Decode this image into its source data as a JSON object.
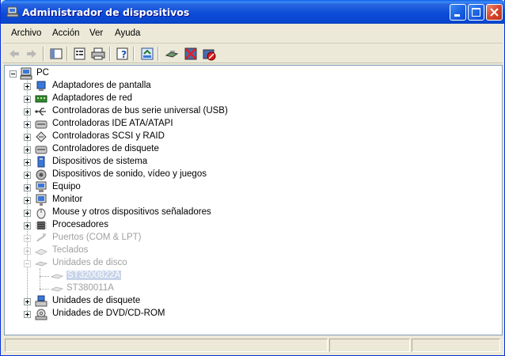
{
  "window": {
    "title": "Administrador de dispositivos",
    "title_bar_color": "#0a4ad8"
  },
  "menu": {
    "items": [
      "Archivo",
      "Acción",
      "Ver",
      "Ayuda"
    ]
  },
  "toolbar": {
    "buttons": [
      "back-arrow-icon",
      "forward-arrow-icon",
      "show-hide-tree-icon",
      "properties-icon",
      "print-icon",
      "help-icon",
      "update-driver-icon",
      "scan-hardware-icon",
      "uninstall-icon",
      "disable-icon"
    ]
  },
  "tree": {
    "root": "PC",
    "items": [
      {
        "label": "Adaptadores de pantalla",
        "icon": "display-adapter-icon",
        "faded": false
      },
      {
        "label": "Adaptadores de red",
        "icon": "network-adapter-icon",
        "faded": false
      },
      {
        "label": "Controladoras de bus serie universal (USB)",
        "icon": "usb-icon",
        "faded": false
      },
      {
        "label": "Controladoras IDE ATA/ATAPI",
        "icon": "ide-controller-icon",
        "faded": false
      },
      {
        "label": "Controladoras SCSI y RAID",
        "icon": "scsi-icon",
        "faded": false
      },
      {
        "label": "Controladores de disquete",
        "icon": "floppy-controller-icon",
        "faded": false
      },
      {
        "label": "Dispositivos de sistema",
        "icon": "system-device-icon",
        "faded": false
      },
      {
        "label": "Dispositivos de sonido, vídeo y juegos",
        "icon": "sound-icon",
        "faded": false
      },
      {
        "label": "Equipo",
        "icon": "computer-icon",
        "faded": false
      },
      {
        "label": "Monitor",
        "icon": "monitor-icon",
        "faded": false
      },
      {
        "label": "Mouse y otros dispositivos señaladores",
        "icon": "mouse-icon",
        "faded": false
      },
      {
        "label": "Procesadores",
        "icon": "processor-icon",
        "faded": false
      },
      {
        "label": "Puertos (COM & LPT)",
        "icon": "port-icon",
        "faded": true
      },
      {
        "label": "Teclados",
        "icon": "keyboard-icon",
        "faded": true
      },
      {
        "label": "Unidades de disco",
        "icon": "disk-drive-icon",
        "faded": true
      },
      {
        "label": "Unidades de disquete",
        "icon": "floppy-drive-icon",
        "faded": false
      },
      {
        "label": "Unidades de DVD/CD-ROM",
        "icon": "dvd-drive-icon",
        "faded": false
      }
    ],
    "disk_children": [
      {
        "label": "ST3200822A",
        "selected": true
      },
      {
        "label": "ST380011A",
        "selected": false
      }
    ]
  }
}
